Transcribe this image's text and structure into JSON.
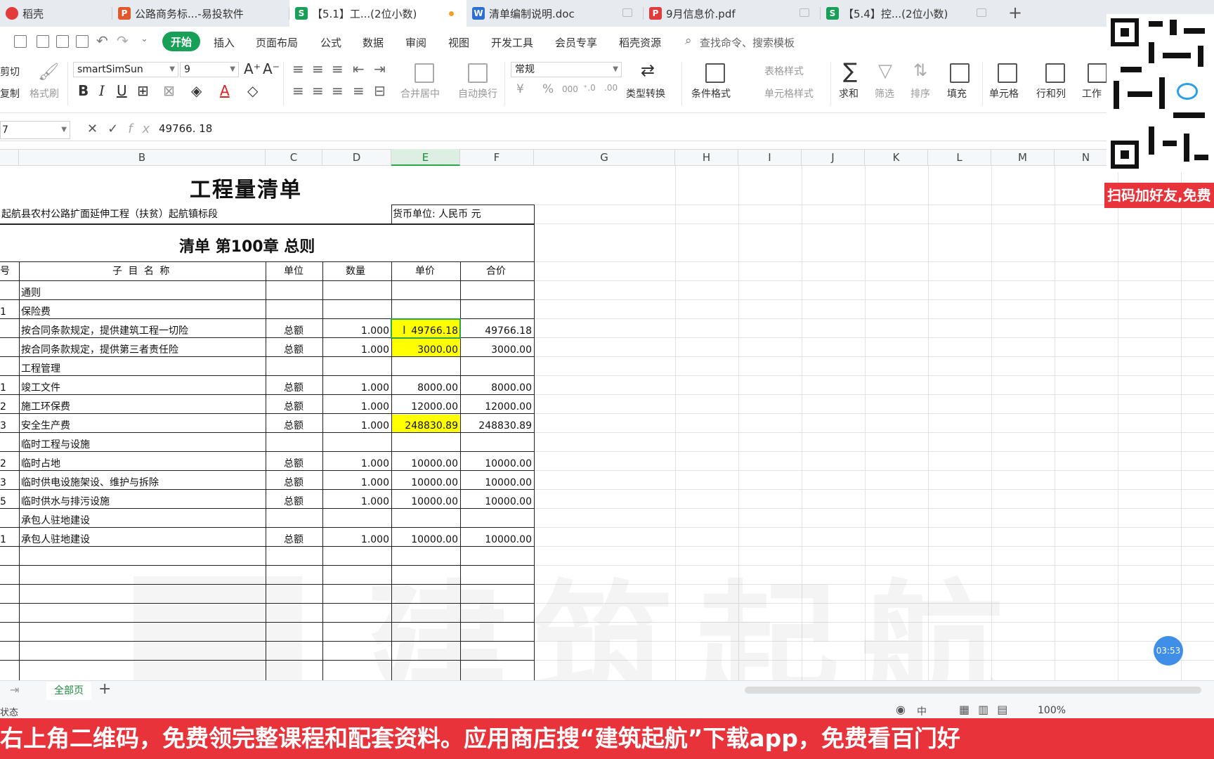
{
  "tabs": [
    {
      "label": "稻壳",
      "icon": "docer-icon",
      "color": "#e23b3b",
      "icon_text": ""
    },
    {
      "label": "公路商务标...-易投软件",
      "icon": "presentation-icon",
      "color": "#e2572b",
      "icon_text": "P"
    },
    {
      "label": "【5.1】工...(2位小数)",
      "icon": "spreadsheet-icon",
      "color": "#18a058",
      "icon_text": "S",
      "active": true
    },
    {
      "label": "清单编制说明.doc",
      "icon": "word-icon",
      "color": "#2b6fd6",
      "icon_text": "W"
    },
    {
      "label": "9月信息价.pdf",
      "icon": "pdf-icon",
      "color": "#e23b3b",
      "icon_text": "P"
    },
    {
      "label": "【5.4】控...(2位小数)",
      "icon": "spreadsheet-icon",
      "color": "#18a058",
      "icon_text": "S"
    }
  ],
  "menu": {
    "start": "开始",
    "items": [
      "插入",
      "页面布局",
      "公式",
      "数据",
      "审阅",
      "视图",
      "开发工具",
      "会员专享",
      "稻壳资源"
    ],
    "search_placeholder": "查找命令、搜索模板"
  },
  "ribbon": {
    "clipboard": {
      "cut": "剪切",
      "copy": "复制",
      "format_painter": "格式刷"
    },
    "font_name": "smartSimSun",
    "font_size": "9",
    "number_format": "常规",
    "labels": {
      "merge_center": "合并居中",
      "wrap_text": "自动换行",
      "type_convert": "类型转换",
      "conditional_format": "条件格式",
      "table_style": "表格样式",
      "cell_style": "单元格样式",
      "sum": "求和",
      "filter": "筛选",
      "sort": "排序",
      "fill": "填充",
      "cell": "单元格",
      "row_col": "行和列",
      "worksheet": "工作"
    }
  },
  "formula_bar": {
    "name_box": "7",
    "value": "49766. 18"
  },
  "columns": [
    "B",
    "C",
    "D",
    "E",
    "F",
    "G",
    "H",
    "I",
    "J",
    "K",
    "L",
    "M",
    "N"
  ],
  "sheet": {
    "title": "工程量清单",
    "project": "起航县农村公路扩面延伸工程（扶贫）起航镇标段",
    "currency": "货币单位: 人民币 元",
    "chapter": "清单 第100章  总则",
    "headers": {
      "no": "号",
      "name": "子 目 名 称",
      "unit": "单位",
      "qty": "数量",
      "price": "单价",
      "total": "合价"
    },
    "rows": [
      {
        "no": "",
        "name": "通则",
        "unit": "",
        "qty": "",
        "price": "",
        "total": ""
      },
      {
        "no": "1",
        "name": "保险费",
        "unit": "",
        "qty": "",
        "price": "",
        "total": ""
      },
      {
        "no": "",
        "name": "按合同条款规定，提供建筑工程一切险",
        "unit": "总额",
        "qty": "1.000",
        "price": "49766.18",
        "total": "49766.18"
      },
      {
        "no": "",
        "name": "按合同条款规定，提供第三者责任险",
        "unit": "总额",
        "qty": "1.000",
        "price": "3000.00",
        "total": "3000.00"
      },
      {
        "no": "",
        "name": "工程管理",
        "unit": "",
        "qty": "",
        "price": "",
        "total": ""
      },
      {
        "no": "1",
        "name": "竣工文件",
        "unit": "总额",
        "qty": "1.000",
        "price": "8000.00",
        "total": "8000.00"
      },
      {
        "no": "2",
        "name": "施工环保费",
        "unit": "总额",
        "qty": "1.000",
        "price": "12000.00",
        "total": "12000.00"
      },
      {
        "no": "3",
        "name": "安全生产费",
        "unit": "总额",
        "qty": "1.000",
        "price": "248830.89",
        "total": "248830.89"
      },
      {
        "no": "",
        "name": "临时工程与设施",
        "unit": "",
        "qty": "",
        "price": "",
        "total": ""
      },
      {
        "no": "2",
        "name": "临时占地",
        "unit": "总额",
        "qty": "1.000",
        "price": "10000.00",
        "total": "10000.00"
      },
      {
        "no": "3",
        "name": "临时供电设施架设、维护与拆除",
        "unit": "总额",
        "qty": "1.000",
        "price": "10000.00",
        "total": "10000.00"
      },
      {
        "no": "5",
        "name": "临时供水与排污设施",
        "unit": "总额",
        "qty": "1.000",
        "price": "10000.00",
        "total": "10000.00"
      },
      {
        "no": "",
        "name": "承包人驻地建设",
        "unit": "",
        "qty": "",
        "price": "",
        "total": ""
      },
      {
        "no": "1",
        "name": "承包人驻地建设",
        "unit": "总额",
        "qty": "1.000",
        "price": "10000.00",
        "total": "10000.00"
      }
    ]
  },
  "watermark": "建筑起航",
  "sheet_tab": "全部页",
  "status": {
    "left": "状态",
    "zoom": "100%"
  },
  "overlays": {
    "qr_banner": "扫码加好友,免费",
    "timer": "03:53",
    "bottom_banner": "右上角二维码，免费领完整课程和配套资料。应用商店搜“建筑起航”下载app，免费看百门好"
  },
  "colors": {
    "accent": "#18a058",
    "highlight": "#ffff00",
    "banner": "#e8333b"
  }
}
